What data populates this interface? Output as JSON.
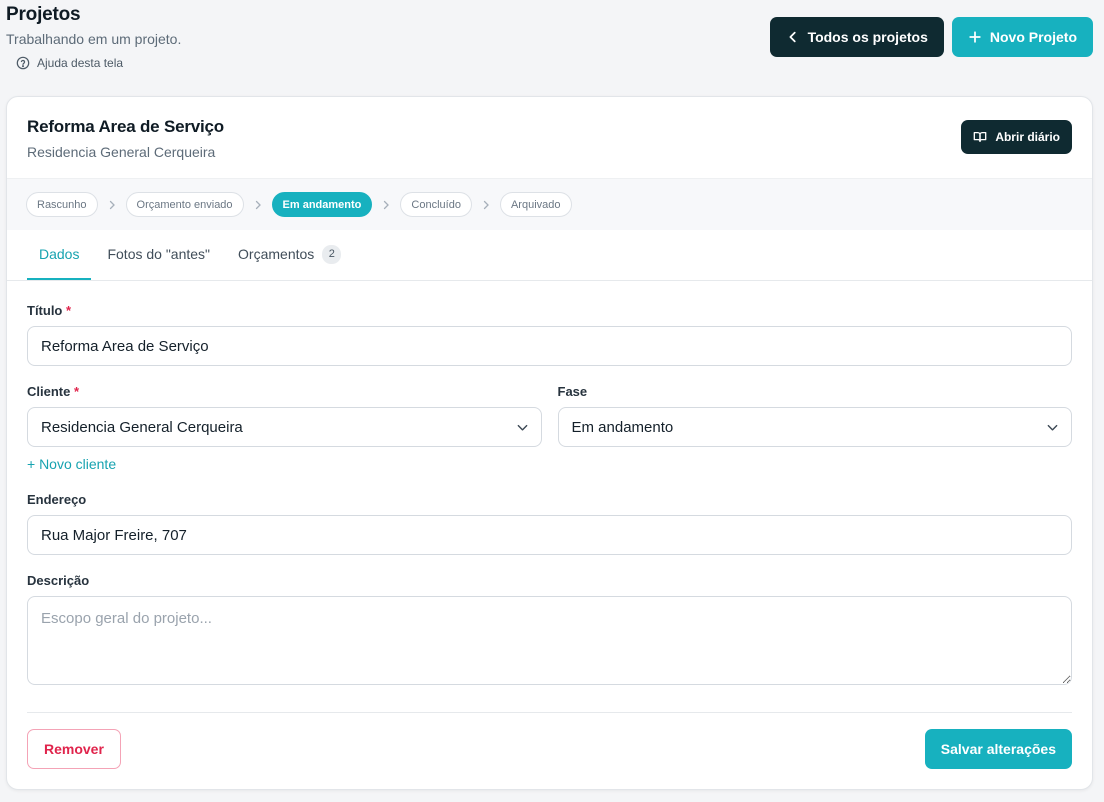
{
  "header": {
    "title": "Projetos",
    "subtitle": "Trabalhando em um projeto.",
    "help_label": "Ajuda desta tela",
    "all_projects_label": "Todos os projetos",
    "new_project_label": "Novo Projeto"
  },
  "project": {
    "name": "Reforma Area de Serviço",
    "client": "Residencia General Cerqueira",
    "open_diary_label": "Abrir diário"
  },
  "stepper": {
    "steps": [
      "Rascunho",
      "Orçamento enviado",
      "Em andamento",
      "Concluído",
      "Arquivado"
    ],
    "active": "Em andamento"
  },
  "tabs": {
    "items": [
      {
        "label": "Dados"
      },
      {
        "label": "Fotos do \"antes\""
      },
      {
        "label": "Orçamentos",
        "count": "2"
      }
    ],
    "active": "Dados"
  },
  "form": {
    "title_label": "Título",
    "title_value": "Reforma Area de Serviço",
    "client_label": "Cliente",
    "client_value": "Residencia General Cerqueira",
    "phase_label": "Fase",
    "phase_value": "Em andamento",
    "new_client_label": "+ Novo cliente",
    "address_label": "Endereço",
    "address_value": "Rua Major Freire, 707",
    "description_label": "Descrição",
    "description_placeholder": "Escopo geral do projeto...",
    "required_mark": "*"
  },
  "footer": {
    "remove_label": "Remover",
    "save_label": "Salvar alterações"
  },
  "colors": {
    "accent": "#17b1bf",
    "dark": "#0f2a31",
    "danger": "#e0244c"
  }
}
